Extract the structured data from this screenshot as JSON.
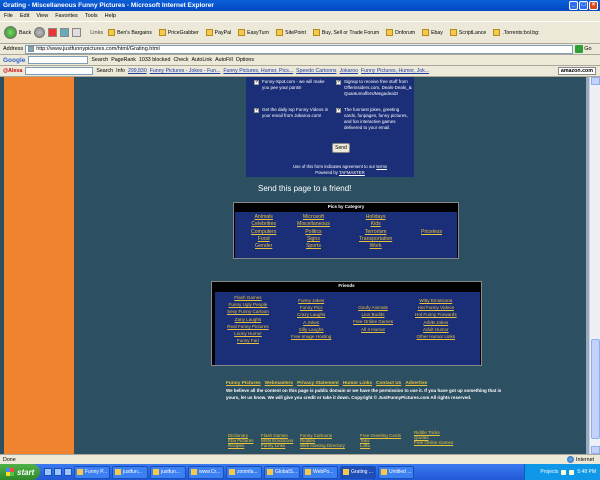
{
  "window": {
    "title": "Grating - Miscellaneous Funny Pictures - Microsoft Internet Explorer"
  },
  "menu": [
    "File",
    "Edit",
    "View",
    "Favorites",
    "Tools",
    "Help"
  ],
  "toolbar": {
    "back_label": "Back",
    "links_label": "Links",
    "links": [
      "Ben's Bargains",
      "PriceGrabber",
      "PayPal",
      "EasyTurn",
      "SitePoint",
      "Buy, Sell or Trade Forum",
      "Dnforum",
      "Ebay",
      "ScriptLance",
      ".Torrents:bol.bg:"
    ]
  },
  "address": {
    "label": "Address",
    "url": "http://www.justfunnypictures.com/html/Grating.html",
    "go_label": "Go"
  },
  "google_bar": {
    "logo": "Google",
    "search_label": "Search",
    "pagerank_label": "PageRank",
    "blocked": "1033 blocked",
    "check_label": "Check",
    "autolink": "AutoLink",
    "autofill": "AutoFill",
    "options": "Options"
  },
  "alexa_bar": {
    "logo": "@Alexa",
    "search_label": "Search",
    "info_label": "Info",
    "rank": "299,830",
    "links": [
      "Funny Pictures - Jokes - Fun...",
      "Funny Pictures, Humor, Pics...",
      "Speedo Cartoons",
      "Jokaroo",
      "Funny Pictures, Humor, Jok..."
    ],
    "amazon": "amazon.com"
  },
  "form": {
    "opt1": "Funny-Spot.com - we will make you pee your pants!",
    "opt2": "Signup to receive free stuff from Offerinsiders.com, Deals-Deals_& Quantumoffers/Megadealz!",
    "opt3": "Get the daily top Funny Videos in your email from Jokaroo.com!",
    "opt4": "The funniest jokes, greeting cards, funpages, funny pictures, and fun interactive games delivered to your email.",
    "send_label": "Send",
    "note_prefix": "Use of this form indicates agreement to our",
    "note_terms": "terms",
    "powered": "Powered by",
    "powered_link": "TAFMASTER"
  },
  "send_page_title": "Send this page to a friend!",
  "categories": {
    "header": "Pics by Category",
    "col1": [
      "Animals",
      "Celebrities",
      "Computers",
      "Food",
      "Gender"
    ],
    "col2": [
      "Microsoft",
      "Miscellaneous",
      "Politics",
      "Signs",
      "Sports"
    ],
    "col3": [
      "Holidays",
      "Kids",
      "Terrorism",
      "Transportation",
      "Work"
    ],
    "col4": [
      "Priceless"
    ]
  },
  "friends": {
    "header": "Friends",
    "col1": [
      "Flash Games",
      "Funny Ugly People",
      "Sexy Funny Cartoon",
      "Zany Laughs",
      "Real Funny Pictures",
      "Loony Humor",
      "Funny Fart"
    ],
    "col2": [
      "Funny Jokes",
      "Funny Pics",
      "Crazy Laughs",
      "A Jokes",
      "Silly Laughs",
      "Free Image Hosting"
    ],
    "col3": [
      "Goofy Animals",
      "Lion Budds",
      "Free Online Games",
      "All 4 Humor"
    ],
    "col4": [
      "Witty Emoticons",
      "Hot Funny Videos",
      "Hot Funny Forwards",
      "Arb/B Jokes",
      "Adult Humor",
      "Other Humor Links"
    ]
  },
  "footer": {
    "links": [
      "Funny Pictures",
      "Webmasters",
      "Privacy Statement",
      "Humor Links",
      "Contact Us",
      "Advertise"
    ],
    "disclaimer": "We believe all the content on this page is public domain or we have the permission to use it. If you have got up something that is yours, let us know. We will give you credit or take it down. Copyright © JustFunnyPictures.com All rights reserved."
  },
  "bottom_links": {
    "col1": [
      "Dictionary",
      "Eba Pictures",
      "Recipes"
    ],
    "col2": [
      "Flash Games",
      "MSN Emoticons",
      "Funny Links"
    ],
    "col3": [
      "Funny Cartoons",
      "Riddles",
      "Web Hosting Directory"
    ],
    "col4": [
      "Free Greeting Cards",
      "Tabs",
      "Lotto"
    ],
    "col5": [
      "Riddle Tricks",
      "Quotes",
      "Free Online Games"
    ]
  },
  "status": {
    "text": "Done",
    "zone": "Internet"
  },
  "taskbar": {
    "start": "start",
    "tasks": [
      "Funny P...",
      "justfun...",
      "justfun...",
      "www.Cr...",
      "zoomfa...",
      "GlobalS...",
      "WebPo...",
      "Grating ...",
      "Untitled ..."
    ],
    "projects": "Projects",
    "clock": "5:48 PM"
  }
}
